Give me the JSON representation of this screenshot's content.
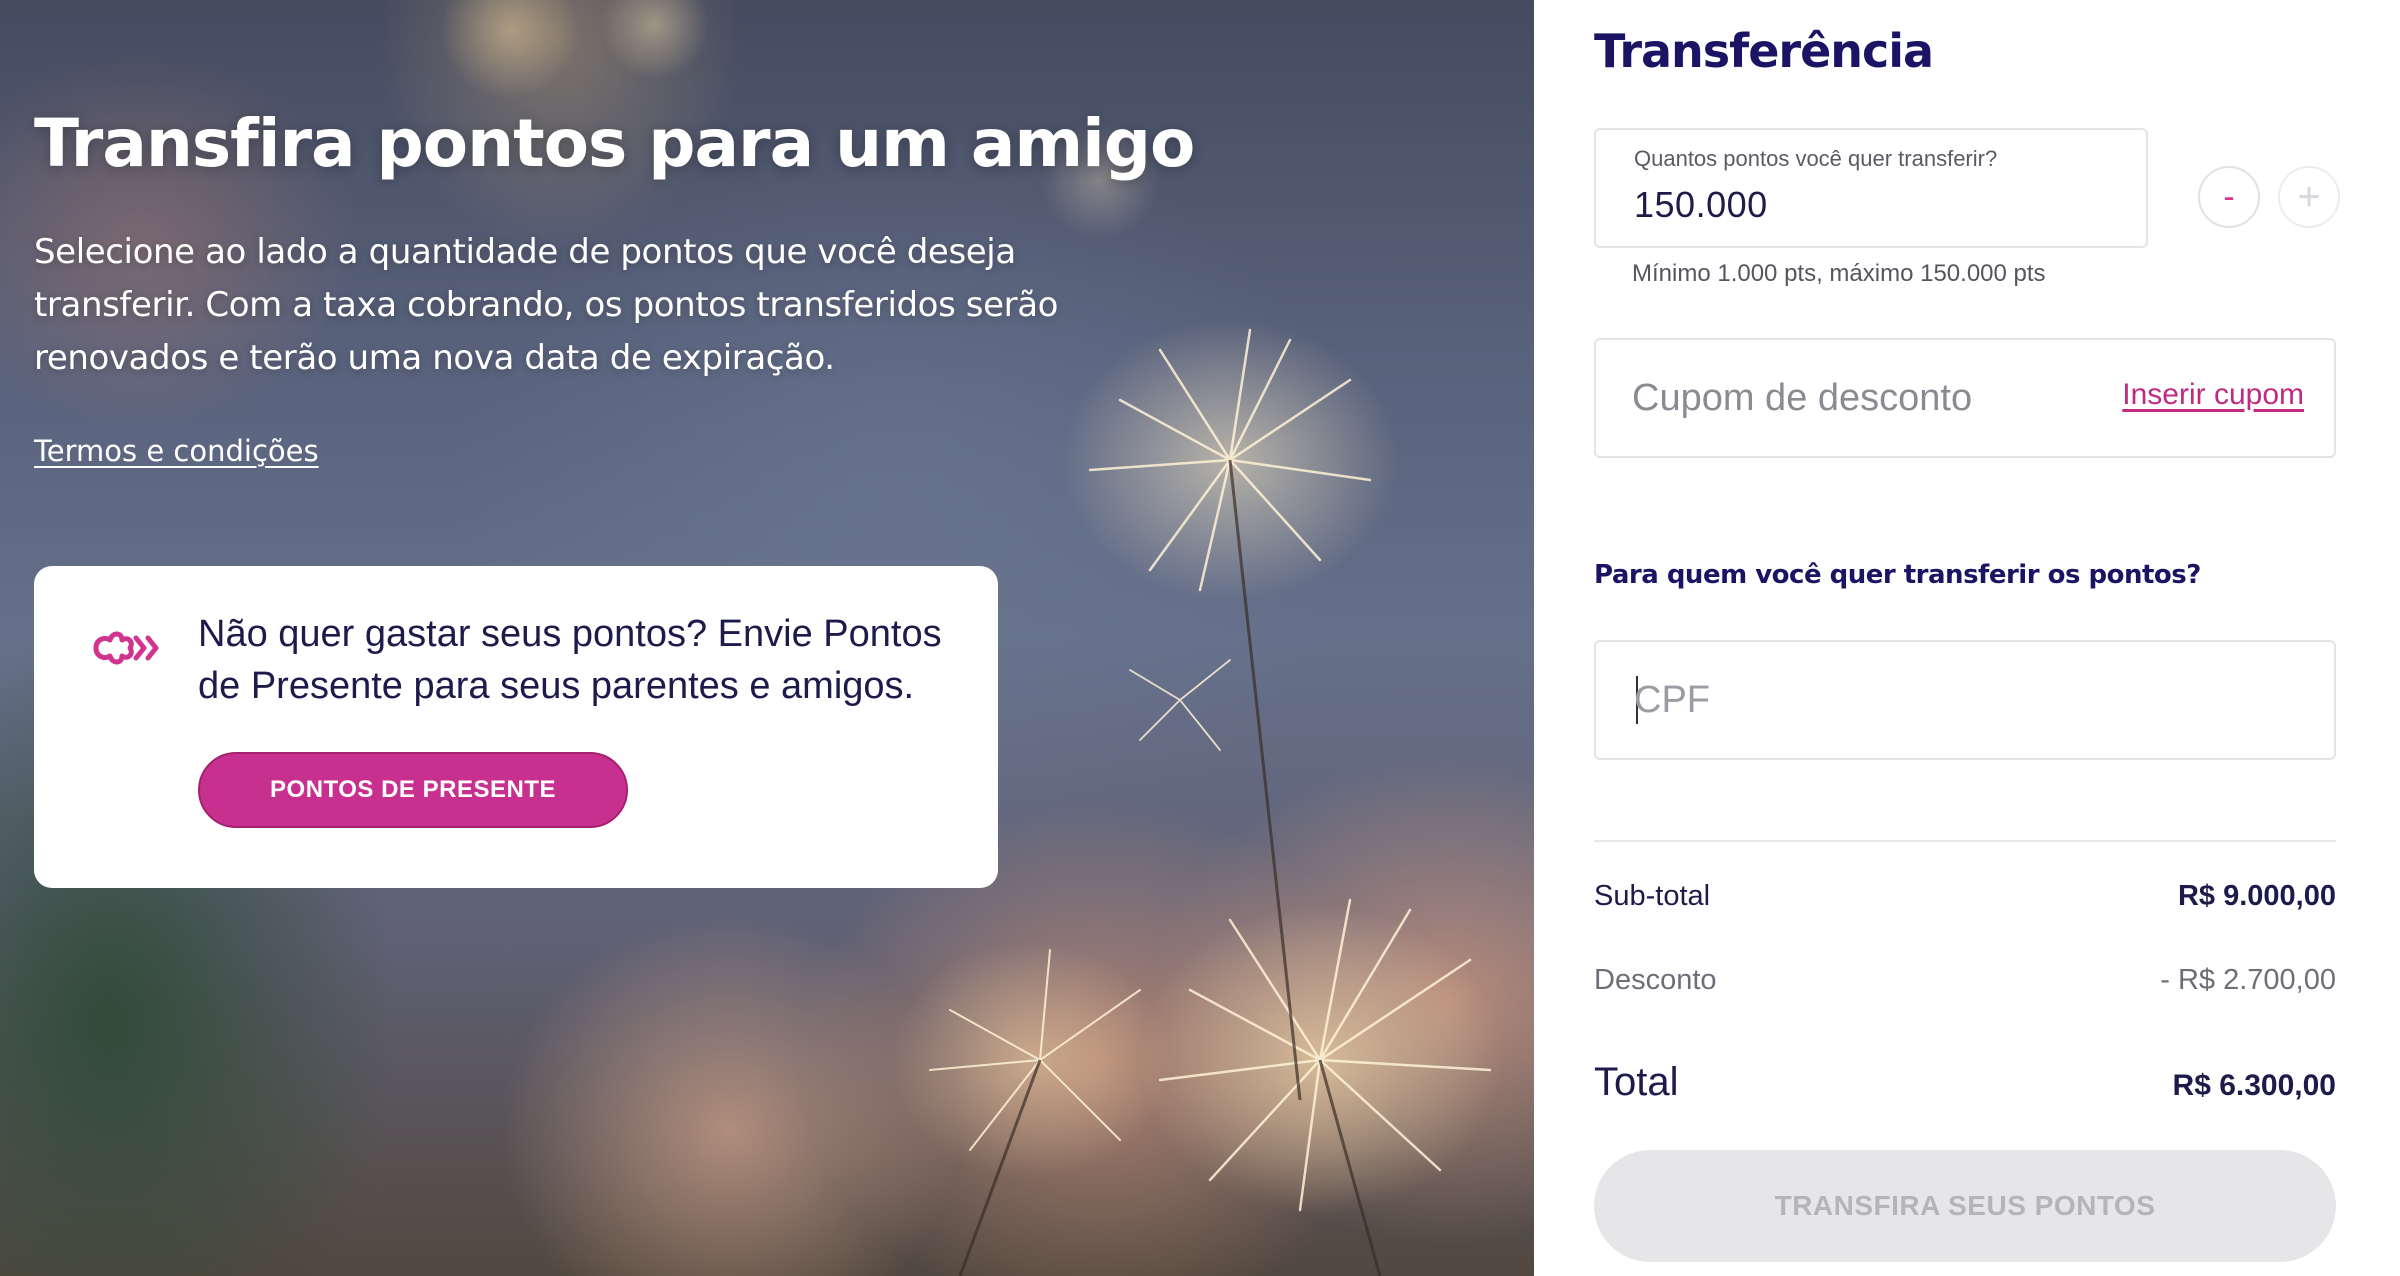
{
  "hero": {
    "title": "Transfira pontos para um amigo",
    "description": "Selecione ao lado a quantidade de pontos que você deseja transferir. Com a taxa cobrando, os pontos transferidos serão renovados e terão uma nova data de expiração.",
    "terms_link": "Termos e condições",
    "background_image": "sparklers-held-in-hands",
    "gift_card": {
      "icon": "gift-points-arrow-icon",
      "text": "Não quer gastar seus pontos? Envie Pontos de Presente para seus parentes e amigos.",
      "button_label": "PONTOS DE PRESENTE"
    }
  },
  "transfer": {
    "title": "Transferência",
    "points_field": {
      "label": "Quantos pontos você quer transferir?",
      "value": "150.000",
      "hint": "Mínimo 1.000 pts, máximo 150.000 pts",
      "decrement_label": "-",
      "increment_label": "+"
    },
    "coupon": {
      "placeholder": "Cupom de desconto",
      "link": "Inserir cupom"
    },
    "recipient_heading": "Para quem você quer transferir os pontos?",
    "cpf": {
      "placeholder": "CPF",
      "value": ""
    },
    "summary": {
      "subtotal_label": "Sub-total",
      "subtotal_value": "R$ 9.000,00",
      "discount_label": "Desconto",
      "discount_value": "- R$ 2.700,00",
      "total_label": "Total",
      "total_value": "R$ 6.300,00"
    },
    "submit_label": "TRANSFIRA SEUS PONTOS",
    "submit_enabled": false
  },
  "colors": {
    "brand_navy": "#1b1464",
    "brand_pink": "#c8308f",
    "link_pink": "#c02a83",
    "disabled_button": "#e6e6e9",
    "disabled_text": "#b4b4ba",
    "field_border": "#e3e3e8"
  }
}
